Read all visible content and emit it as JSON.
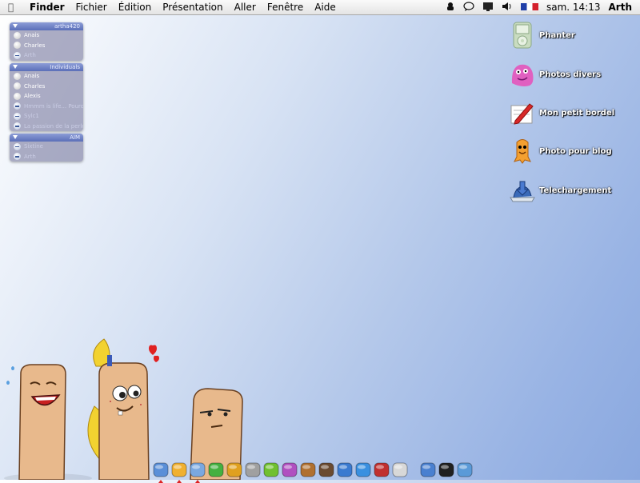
{
  "menubar": {
    "app": "Finder",
    "items": [
      "Fichier",
      "Édition",
      "Présentation",
      "Aller",
      "Fenêtre",
      "Aide"
    ],
    "clock": "sam. 14:13",
    "user": "Arth"
  },
  "buddy_panels": [
    {
      "title": "artha420",
      "buddies": [
        {
          "name": "Anais",
          "status": "online"
        },
        {
          "name": "Charles",
          "status": "online"
        },
        {
          "name": "Arth",
          "status": "away"
        }
      ]
    },
    {
      "title": "Individuals",
      "buddies": [
        {
          "name": "Anais",
          "status": "online"
        },
        {
          "name": "Charles",
          "status": "online"
        },
        {
          "name": "Alexis",
          "status": "online"
        },
        {
          "name": "Hmmm is life... Pourq...",
          "status": "away"
        },
        {
          "name": "Sylc1",
          "status": "away"
        },
        {
          "name": "La passion de la perle",
          "status": "away"
        }
      ]
    },
    {
      "title": "AIM",
      "buddies": [
        {
          "name": "Sixtine",
          "status": "away"
        },
        {
          "name": "Arth",
          "status": "away"
        }
      ]
    }
  ],
  "desktop_icons": [
    {
      "label": "Phanter",
      "icon": "ipod-icon"
    },
    {
      "label": "Photos divers",
      "icon": "pink-monster-icon"
    },
    {
      "label": "Mon petit bordel",
      "icon": "pencil-icon"
    },
    {
      "label": "Photo pour blog",
      "icon": "orange-monster-icon"
    },
    {
      "label": "Telechargement",
      "icon": "download-icon"
    }
  ],
  "dock_items": [
    {
      "name": "finder-icon",
      "color": "#5a8fd8"
    },
    {
      "name": "mail-icon",
      "color": "#f0b030"
    },
    {
      "name": "safari-icon",
      "color": "#7aa8e0"
    },
    {
      "name": "address-book-icon",
      "color": "#45b040"
    },
    {
      "name": "chat-icon",
      "color": "#e0a020"
    },
    {
      "name": "robot-icon",
      "color": "#a0a0a0"
    },
    {
      "name": "frog-icon",
      "color": "#70c030"
    },
    {
      "name": "purple-creature-icon",
      "color": "#b050c0"
    },
    {
      "name": "guitar-icon",
      "color": "#b07030"
    },
    {
      "name": "photo-icon",
      "color": "#6a4a30"
    },
    {
      "name": "fish-icon",
      "color": "#3a7ad0"
    },
    {
      "name": "quicktime-icon",
      "color": "#3a90e0"
    },
    {
      "name": "bug-icon",
      "color": "#c03030"
    },
    {
      "name": "display-icon",
      "color": "#d8d8d8"
    },
    {
      "name": "network-icon",
      "color": "#4a80d0"
    },
    {
      "name": "terminal-icon",
      "color": "#202020"
    },
    {
      "name": "trash-icon",
      "color": "#5a9ad8"
    }
  ]
}
